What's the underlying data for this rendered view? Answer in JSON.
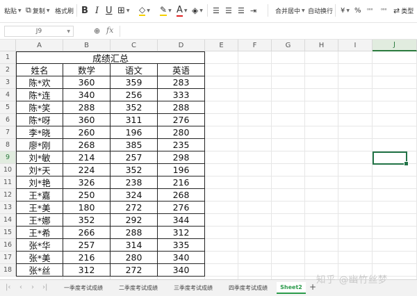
{
  "toolbar": {
    "paste_label": "粘贴",
    "copy_label": "复制",
    "format_painter_label": "格式刷",
    "bold": "B",
    "italic": "I",
    "underline": "U",
    "font_color_label": "A",
    "merge_center_label": "合并居中",
    "wrap_text_label": "自动换行",
    "currency_symbol": "¥",
    "percent_symbol": "%",
    "type_label": "类型"
  },
  "formula_bar": {
    "cell_ref": "J9",
    "fx": "fx",
    "content": ""
  },
  "columns": [
    "A",
    "B",
    "C",
    "D",
    "E",
    "F",
    "G",
    "H",
    "I",
    "J"
  ],
  "row_numbers": [
    "1",
    "2",
    "3",
    "4",
    "5",
    "6",
    "7",
    "8",
    "9",
    "10",
    "11",
    "12",
    "13",
    "14",
    "15",
    "16",
    "17",
    "18"
  ],
  "sheet": {
    "title": "成绩汇总",
    "headers": [
      "姓名",
      "数学",
      "语文",
      "英语"
    ],
    "rows": [
      [
        "陈*欢",
        "360",
        "359",
        "283"
      ],
      [
        "陈*连",
        "340",
        "256",
        "333"
      ],
      [
        "陈*笑",
        "288",
        "352",
        "288"
      ],
      [
        "陈*呀",
        "360",
        "311",
        "276"
      ],
      [
        "李*晓",
        "260",
        "196",
        "280"
      ],
      [
        "廖*刚",
        "268",
        "385",
        "235"
      ],
      [
        "刘*敏",
        "214",
        "257",
        "298"
      ],
      [
        "刘*天",
        "224",
        "352",
        "196"
      ],
      [
        "刘*艳",
        "326",
        "238",
        "216"
      ],
      [
        "王*嘉",
        "250",
        "324",
        "268"
      ],
      [
        "王*美",
        "180",
        "272",
        "276"
      ],
      [
        "王*娜",
        "352",
        "292",
        "344"
      ],
      [
        "王*希",
        "266",
        "288",
        "312"
      ],
      [
        "张*华",
        "257",
        "314",
        "335"
      ],
      [
        "张*美",
        "216",
        "280",
        "340"
      ],
      [
        "张*丝",
        "312",
        "272",
        "340"
      ]
    ]
  },
  "sheet_tabs": [
    "一季度考试成绩",
    "二季度考试成绩",
    "三季度考试成绩",
    "四季度考试成绩",
    "Sheet2"
  ],
  "active_tab": "Sheet2",
  "watermark": "知乎 @幽竹丝梦",
  "colors": {
    "accent": "#217346",
    "active_tab": "#2a9a4a"
  }
}
